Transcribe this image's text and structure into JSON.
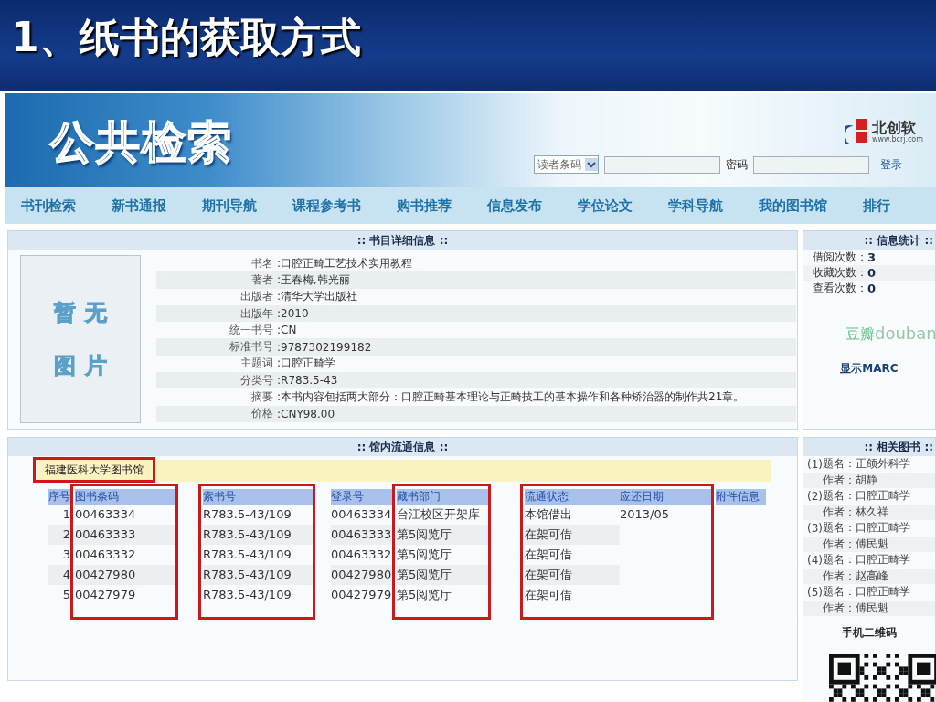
{
  "slide_title": "1、纸书的获取方式",
  "site": {
    "logo": "公共检索",
    "vendor_name": "北创软",
    "vendor_url": "www.bcrj.com",
    "login": {
      "select": "读者条码",
      "password_label": "密码",
      "login_link": "登录"
    }
  },
  "nav": [
    "书刊检索",
    "新书通报",
    "期刊导航",
    "课程参考书",
    "购书推荐",
    "信息发布",
    "学位论文",
    "学科导航",
    "我的图书馆",
    "排行"
  ],
  "detail": {
    "title": ":: 书目详细信息 ::",
    "cover_placeholder": "暂无图片",
    "fields": [
      {
        "label": "书名",
        "value": ":口腔正畸工艺技术实用教程"
      },
      {
        "label": "著者",
        "value": ":王春梅,韩光丽"
      },
      {
        "label": "出版者",
        "value": ":清华大学出版社"
      },
      {
        "label": "出版年",
        "value": ":2010"
      },
      {
        "label": "统一书号",
        "value": ":CN"
      },
      {
        "label": "标准书号",
        "value": ":9787302199182"
      },
      {
        "label": "主题词",
        "value": ":口腔正畸学"
      },
      {
        "label": "分类号",
        "value": ":R783.5-43"
      },
      {
        "label": "摘要",
        "value": ":本书内容包括两大部分：口腔正畸基本理论与正畸技工的基本操作和各种矫治器的制作共21章。"
      },
      {
        "label": "价格",
        "value": ":CNY98.00"
      }
    ]
  },
  "stats": {
    "title": ":: 信息统计 ::",
    "items": [
      {
        "label": "借阅次数：",
        "value": "3"
      },
      {
        "label": "收藏次数：",
        "value": "0"
      },
      {
        "label": "查看次数：",
        "value": "0"
      }
    ],
    "douban": [
      "豆瓣",
      "douban"
    ],
    "marc_link": "显示MARC"
  },
  "circulation": {
    "title": ":: 馆内流通信息 ::",
    "library": {
      "name": "福建医科大学图书馆",
      "highlighted": true
    },
    "column_groups": [
      {
        "highlighted": false,
        "columns": [
          {
            "header": "序号",
            "cells": [
              "1",
              "2",
              "3",
              "4",
              "5"
            ]
          }
        ]
      },
      {
        "highlighted": true,
        "columns": [
          {
            "header": "图书条码",
            "cells": [
              "00463334",
              "00463333",
              "00463332",
              "00427980",
              "00427979"
            ]
          }
        ]
      },
      {
        "highlighted": true,
        "columns": [
          {
            "header": "索书号",
            "cells": [
              "R783.5-43/109",
              "R783.5-43/109",
              "R783.5-43/109",
              "R783.5-43/109",
              "R783.5-43/109"
            ]
          }
        ]
      },
      {
        "highlighted": false,
        "columns": [
          {
            "header": "登录号",
            "cells": [
              "00463334",
              "00463333",
              "00463332",
              "00427980",
              "00427979"
            ]
          }
        ]
      },
      {
        "highlighted": true,
        "columns": [
          {
            "header": "藏书部门",
            "cells": [
              "台江校区开架库",
              "第5阅览厅",
              "第5阅览厅",
              "第5阅览厅",
              "第5阅览厅"
            ]
          }
        ]
      },
      {
        "highlighted": true,
        "columns": [
          {
            "header": "流通状态",
            "cells": [
              "本馆借出",
              "在架可借",
              "在架可借",
              "在架可借",
              "在架可借"
            ]
          },
          {
            "header": "应还日期",
            "cells": [
              "2013/05"
            ]
          }
        ]
      },
      {
        "highlighted": false,
        "columns": [
          {
            "header": "附件信息"
          }
        ]
      }
    ]
  },
  "related": {
    "title": ":: 相关图书 ::",
    "books": [
      {
        "index": "(1)",
        "title_label": "题名：",
        "title": "正颌外科学",
        "author_label": "作者：",
        "author": "胡静"
      },
      {
        "index": "(2)",
        "title_label": "题名：",
        "title": "口腔正畸学",
        "author_label": "作者：",
        "author": "林久祥"
      },
      {
        "index": "(3)",
        "title_label": "题名：",
        "title": "口腔正畸学",
        "author_label": "作者：",
        "author": "傅民魁"
      },
      {
        "index": "(4)",
        "title_label": "题名：",
        "title": "口腔正畸学",
        "author_label": "作者：",
        "author": "赵高峰"
      },
      {
        "index": "(5)",
        "title_label": "题名：",
        "title": "口腔正畸学",
        "author_label": "作者：",
        "author": "傅民魁"
      }
    ],
    "qr_label": "手机二维码"
  }
}
